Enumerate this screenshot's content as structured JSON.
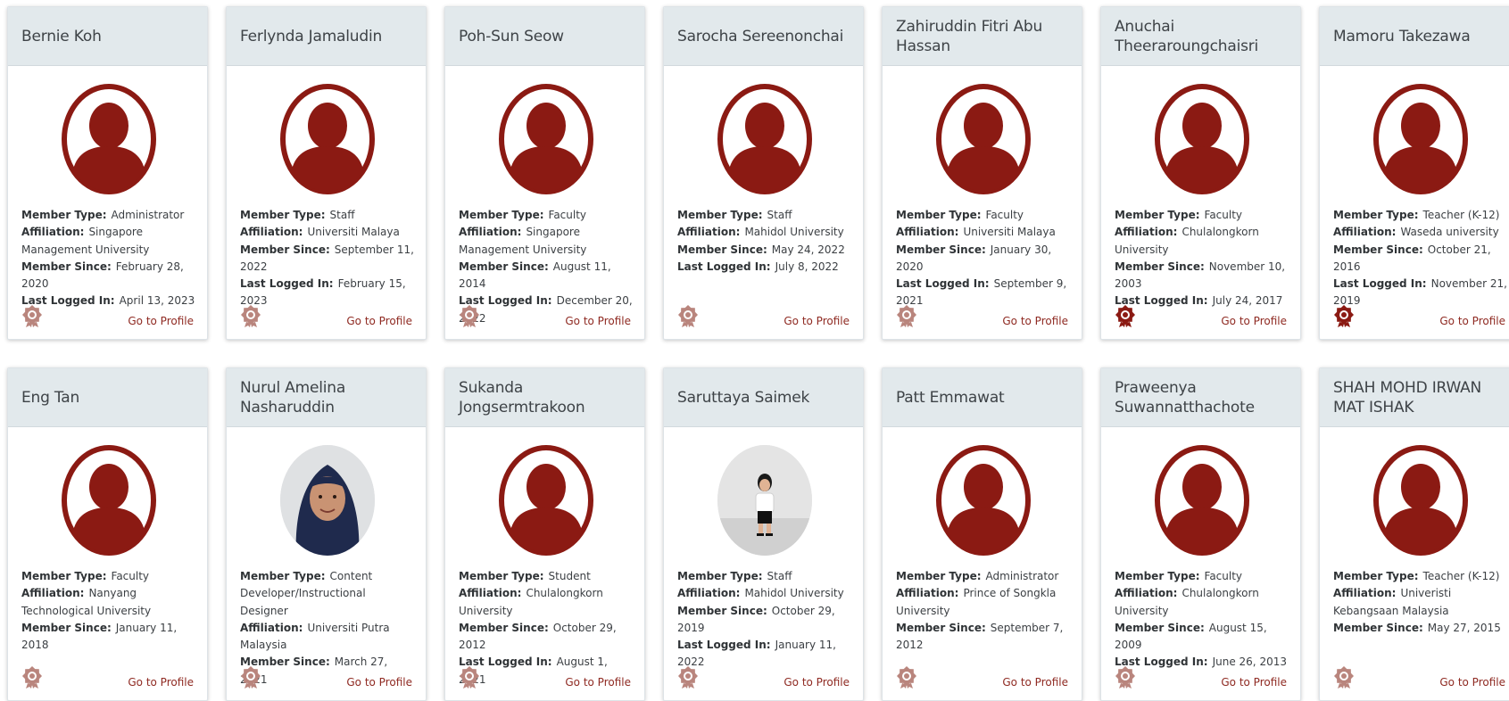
{
  "labels": {
    "member_type": "Member Type:",
    "affiliation": "Affiliation:",
    "member_since": "Member Since:",
    "last_logged_in": "Last Logged In:",
    "go_to_profile": "Go to Profile"
  },
  "colors": {
    "accent": "#8b1a13",
    "header_bg": "#e2e9ec",
    "badge_muted": "#b9857d",
    "badge_active": "#8b1a13"
  },
  "icons": {
    "avatar": "user-avatar-icon",
    "badge": "award-badge-icon"
  },
  "members": [
    {
      "name": "Bernie Koh",
      "member_type": "Administrator",
      "affiliation": "Singapore Management University",
      "member_since": "February 28, 2020",
      "last_logged_in": "April 13, 2023",
      "badge": "muted"
    },
    {
      "name": "Ferlynda Jamaludin",
      "member_type": "Staff",
      "affiliation": "Universiti Malaya",
      "member_since": "September 11, 2022",
      "last_logged_in": "February 15, 2023",
      "badge": "muted"
    },
    {
      "name": "Poh-Sun Seow",
      "member_type": "Faculty",
      "affiliation": "Singapore Management University",
      "member_since": "August 11, 2014",
      "last_logged_in": "December 20, 2022",
      "badge": "muted"
    },
    {
      "name": "Sarocha Sereenonchai",
      "member_type": "Staff",
      "affiliation": "Mahidol University",
      "member_since": "May 24, 2022",
      "last_logged_in": "July 8, 2022",
      "badge": "muted"
    },
    {
      "name": "Zahiruddin Fitri Abu Hassan",
      "member_type": "Faculty",
      "affiliation": "Universiti Malaya",
      "member_since": "January 30, 2020",
      "last_logged_in": "September 9, 2021",
      "badge": "muted"
    },
    {
      "name": "Anuchai Theeraroungchaisri",
      "member_type": "Faculty",
      "affiliation": "Chulalongkorn University",
      "member_since": "November 10, 2003",
      "last_logged_in": "July 24, 2017",
      "badge": "active"
    },
    {
      "name": "Mamoru Takezawa",
      "member_type": "Teacher (K-12)",
      "affiliation": "Waseda university",
      "member_since": "October 21, 2016",
      "last_logged_in": "November 21, 2019",
      "badge": "active"
    },
    {
      "name": "Eng Tan",
      "member_type": "Faculty",
      "affiliation": "Nanyang Technological University",
      "member_since": "January 11, 2018",
      "last_logged_in": "",
      "badge": "muted"
    },
    {
      "name": "Nurul Amelina Nasharuddin",
      "member_type": "Content Developer/Instructional Designer",
      "affiliation": "Universiti Putra Malaysia",
      "member_since": "March 27, 2021",
      "last_logged_in": "",
      "badge": "muted",
      "photo": "hijab"
    },
    {
      "name": "Sukanda Jongsermtrakoon",
      "member_type": "Student",
      "affiliation": "Chulalongkorn University",
      "member_since": "October 29, 2012",
      "last_logged_in": "August 1, 2021",
      "badge": "muted"
    },
    {
      "name": "Saruttaya Saimek",
      "member_type": "Staff",
      "affiliation": "Mahidol University",
      "member_since": "October 29, 2019",
      "last_logged_in": "January 11, 2022",
      "badge": "muted",
      "photo": "fullbody"
    },
    {
      "name": "Patt Emmawat",
      "member_type": "Administrator",
      "affiliation": "Prince of Songkla University",
      "member_since": "September 7, 2012",
      "last_logged_in": "",
      "badge": "muted"
    },
    {
      "name": "Praweenya Suwannatthachote",
      "member_type": "Faculty",
      "affiliation": "Chulalongkorn University",
      "member_since": "August 15, 2009",
      "last_logged_in": "June 26, 2013",
      "badge": "muted"
    },
    {
      "name": "SHAH MOHD IRWAN MAT ISHAK",
      "member_type": "Teacher (K-12)",
      "affiliation": "Univeristi Kebangsaan Malaysia",
      "member_since": "May 27, 2015",
      "last_logged_in": "",
      "badge": "muted"
    }
  ]
}
